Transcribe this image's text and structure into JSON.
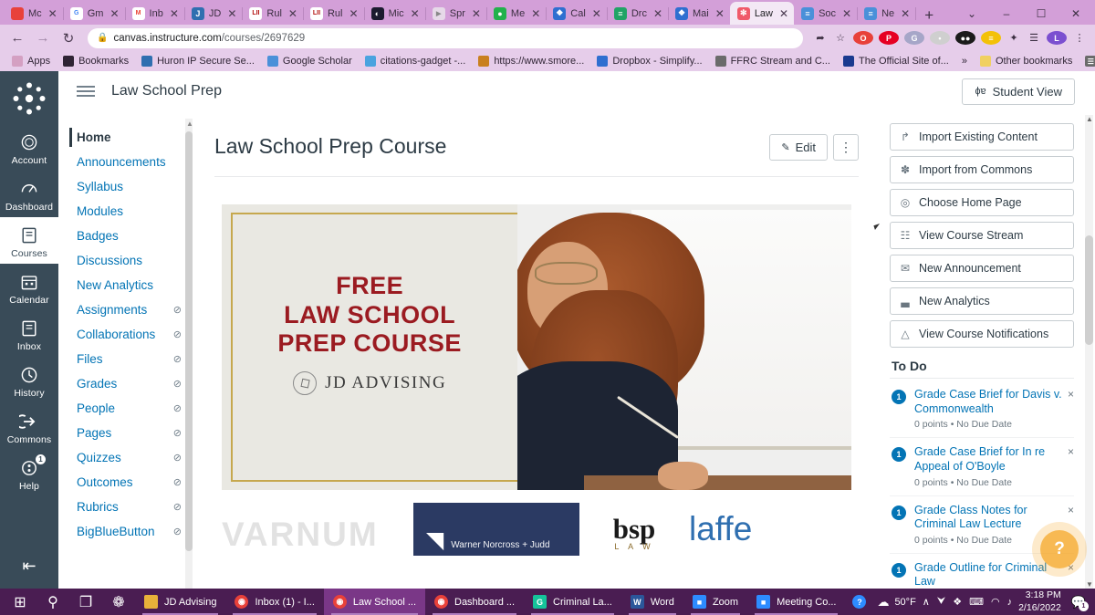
{
  "browser": {
    "tabs": [
      {
        "label": "Mc",
        "favicon": "red-circle-icon",
        "fav_color": "#e8413a",
        "active": false
      },
      {
        "label": "Gm",
        "favicon": "google-icon",
        "fav_color": "#ffffff",
        "active": false
      },
      {
        "label": "Inb",
        "favicon": "gmail-icon",
        "fav_color": "#ffffff",
        "active": false
      },
      {
        "label": "JD",
        "favicon": "jd-advising-icon",
        "fav_color": "#2f6fb0",
        "active": false
      },
      {
        "label": "Rul",
        "favicon": "lii-icon",
        "fav_color": "#ffffff",
        "active": false
      },
      {
        "label": "Rul",
        "favicon": "lii-icon",
        "fav_color": "#ffffff",
        "active": false
      },
      {
        "label": "Mic",
        "favicon": "globe-icon",
        "fav_color": "#1b1b2f",
        "active": false
      },
      {
        "label": "Spr",
        "favicon": "play-icon",
        "fav_color": "#e6d9e8",
        "active": false
      },
      {
        "label": "Me",
        "favicon": "green-circle-icon",
        "fav_color": "#22b14c",
        "active": false
      },
      {
        "label": "Cal",
        "favicon": "dropbox-icon",
        "fav_color": "#2f6fd0",
        "active": false
      },
      {
        "label": "Drc",
        "favicon": "sheets-icon",
        "fav_color": "#21a366",
        "active": false
      },
      {
        "label": "Mai",
        "favicon": "dropbox-icon",
        "fav_color": "#2f6fd0",
        "active": false
      },
      {
        "label": "Law",
        "favicon": "canvas-icon",
        "fav_color": "#f05a6a",
        "active": true
      },
      {
        "label": "Soc",
        "favicon": "document-icon",
        "fav_color": "#4a90d9",
        "active": false
      },
      {
        "label": "Ne",
        "favicon": "document-icon",
        "fav_color": "#4a90d9",
        "active": false
      }
    ],
    "new_tab_label": "+",
    "window_controls": [
      "⌄",
      "–",
      "☐",
      "✕"
    ],
    "nav": {
      "back": "←",
      "forward": "→",
      "reload": "↻"
    },
    "url_main": "canvas.instructure.com",
    "url_path": "/courses/2697629",
    "lock_icon": "lock-icon",
    "omnibox_icons": [
      {
        "name": "share-icon",
        "glyph": "➦"
      },
      {
        "name": "bookmark-star-icon",
        "glyph": "☆"
      },
      {
        "name": "opera-extension-icon",
        "glyph": "O",
        "color": "#e8413a"
      },
      {
        "name": "pinterest-extension-icon",
        "glyph": "P",
        "color": "#e60023"
      },
      {
        "name": "grammarly-extension-icon",
        "glyph": "G",
        "color": "#a6a6c8"
      },
      {
        "name": "lastpass-extension-icon",
        "glyph": "•",
        "color": "#cfcfcf"
      },
      {
        "name": "zoom-extension-icon",
        "glyph": "●●",
        "color": "#1b1b1b"
      },
      {
        "name": "notes-extension-icon",
        "glyph": "≡",
        "color": "#f3c108"
      },
      {
        "name": "extensions-puzzle-icon",
        "glyph": "✦"
      },
      {
        "name": "reading-list-icon",
        "glyph": "☰"
      },
      {
        "name": "profile-avatar-icon",
        "glyph": "L",
        "color": "#7b4fd0"
      },
      {
        "name": "chrome-menu-icon",
        "glyph": "⋮"
      }
    ],
    "bookmarks": [
      {
        "label": "Apps",
        "icon": "apps-grid-icon",
        "color": "#d4a0c2"
      },
      {
        "label": "Bookmarks",
        "icon": "star-icon",
        "color": "#2f2434"
      },
      {
        "label": "Huron IP Secure Se...",
        "icon": "huron-icon",
        "color": "#2f6fb0"
      },
      {
        "label": "Google Scholar",
        "icon": "scholar-icon",
        "color": "#4a90d9"
      },
      {
        "label": "citations-gadget -...",
        "icon": "home-icon",
        "color": "#4aa3df"
      },
      {
        "label": "https://www.smore...",
        "icon": "smore-icon",
        "color": "#c9801f"
      },
      {
        "label": "Dropbox - Simplify...",
        "icon": "dropbox-icon",
        "color": "#2f6fd0"
      },
      {
        "label": "FFRC Stream and C...",
        "icon": "wolf-icon",
        "color": "#6b6b6b"
      },
      {
        "label": "The Official Site of...",
        "icon": "flag-icon",
        "color": "#1a3a8f"
      }
    ],
    "bookmarks_overflow": "»",
    "other_bookmarks": "Other bookmarks",
    "reading_list": "Reading list"
  },
  "canvas": {
    "global_nav": {
      "logo_name": "canvas-logo",
      "items": [
        {
          "label": "Account",
          "icon": "account-avatar-icon",
          "active": false,
          "badge": null
        },
        {
          "label": "Dashboard",
          "icon": "dashboard-icon",
          "active": false,
          "badge": null
        },
        {
          "label": "Courses",
          "icon": "courses-book-icon",
          "active": true,
          "badge": null
        },
        {
          "label": "Calendar",
          "icon": "calendar-icon",
          "active": false,
          "badge": null
        },
        {
          "label": "Inbox",
          "icon": "inbox-icon",
          "active": false,
          "badge": null
        },
        {
          "label": "History",
          "icon": "history-clock-icon",
          "active": false,
          "badge": null
        },
        {
          "label": "Commons",
          "icon": "commons-icon",
          "active": false,
          "badge": null
        },
        {
          "label": "Help",
          "icon": "help-icon",
          "active": false,
          "badge": "1"
        }
      ],
      "collapse_label": "⇤"
    },
    "header": {
      "menu_icon": "hamburger-menu-icon",
      "course_name": "Law School Prep",
      "student_view_label": "Student View",
      "student_view_icon": "eye-glasses-icon"
    },
    "course_nav": [
      {
        "label": "Home",
        "active": true,
        "hidden": false
      },
      {
        "label": "Announcements",
        "active": false,
        "hidden": false
      },
      {
        "label": "Syllabus",
        "active": false,
        "hidden": false
      },
      {
        "label": "Modules",
        "active": false,
        "hidden": false
      },
      {
        "label": "Badges",
        "active": false,
        "hidden": false
      },
      {
        "label": "Discussions",
        "active": false,
        "hidden": false
      },
      {
        "label": "New Analytics",
        "active": false,
        "hidden": false
      },
      {
        "label": "Assignments",
        "active": false,
        "hidden": true
      },
      {
        "label": "Collaborations",
        "active": false,
        "hidden": true
      },
      {
        "label": "Files",
        "active": false,
        "hidden": true
      },
      {
        "label": "Grades",
        "active": false,
        "hidden": true
      },
      {
        "label": "People",
        "active": false,
        "hidden": true
      },
      {
        "label": "Pages",
        "active": false,
        "hidden": true
      },
      {
        "label": "Quizzes",
        "active": false,
        "hidden": true
      },
      {
        "label": "Outcomes",
        "active": false,
        "hidden": true
      },
      {
        "label": "Rubrics",
        "active": false,
        "hidden": true
      },
      {
        "label": "BigBlueButton",
        "active": false,
        "hidden": true
      }
    ],
    "page": {
      "title": "Law School Prep Course",
      "edit_label": "Edit",
      "edit_icon": "pencil-icon",
      "kebab_label": "⋮"
    },
    "hero": {
      "line1": "FREE",
      "line2": "LAW SCHOOL",
      "line3": "PREP COURSE",
      "brand": "JD ADVISING",
      "brand_icon": "jd-seal-icon",
      "title_color": "#9b1b21",
      "frame_color": "#c6a84e"
    },
    "logos": [
      {
        "name": "varnum-logo",
        "text": "VARNUM"
      },
      {
        "name": "warner-norcross-judd-logo",
        "text": "Warner Norcross + Judd"
      },
      {
        "name": "bsp-law-logo",
        "text": "bsp",
        "sub": "L A W"
      },
      {
        "name": "laffe-logo",
        "text": "laffe"
      }
    ],
    "right_rail": {
      "buttons": [
        {
          "label": "Import Existing Content",
          "icon": "import-icon",
          "glyph": "↱"
        },
        {
          "label": "Import from Commons",
          "icon": "commons-icon",
          "glyph": "✽"
        },
        {
          "label": "Choose Home Page",
          "icon": "target-icon",
          "glyph": "◎"
        },
        {
          "label": "View Course Stream",
          "icon": "stream-icon",
          "glyph": "☷"
        },
        {
          "label": "New Announcement",
          "icon": "announcement-icon",
          "glyph": "✉"
        },
        {
          "label": "New Analytics",
          "icon": "analytics-icon",
          "glyph": "▃"
        },
        {
          "label": "View Course Notifications",
          "icon": "bell-icon",
          "glyph": "△"
        }
      ],
      "todo_heading": "To Do",
      "todo_items": [
        {
          "count": "1",
          "title": "Grade Case Brief for Davis v. Commonwealth",
          "meta": "0 points • No Due Date",
          "close": "×"
        },
        {
          "count": "1",
          "title": "Grade Case Brief for In re Appeal of O'Boyle",
          "meta": "0 points • No Due Date",
          "close": "×"
        },
        {
          "count": "1",
          "title": "Grade Class Notes for Criminal Law Lecture",
          "meta": "0 points • No Due Date",
          "close": "×"
        },
        {
          "count": "1",
          "title": "Grade Outline for Criminal Law",
          "meta": "",
          "close": "×"
        }
      ],
      "help_bubble_label": "?"
    }
  },
  "taskbar": {
    "system": [
      {
        "name": "start-button",
        "glyph": "⊞"
      },
      {
        "name": "search-icon",
        "glyph": "⚲"
      },
      {
        "name": "task-view-icon",
        "glyph": "❐"
      },
      {
        "name": "cortana-icon",
        "glyph": "❁"
      }
    ],
    "apps": [
      {
        "label": "JD Advising",
        "icon": "folder-icon",
        "color": "#e8b23a",
        "active": false,
        "open": true
      },
      {
        "label": "Inbox (1) - I...",
        "icon": "chrome-icon",
        "color": "#e8413a",
        "active": false,
        "open": true
      },
      {
        "label": "Law School ...",
        "icon": "chrome-icon",
        "color": "#e8413a",
        "active": true,
        "open": true
      },
      {
        "label": "Dashboard ...",
        "icon": "chrome-icon",
        "color": "#e8413a",
        "active": false,
        "open": true
      },
      {
        "label": "Criminal La...",
        "icon": "grammarly-icon",
        "color": "#15c39a",
        "active": false,
        "open": true
      },
      {
        "label": "Word",
        "icon": "word-icon",
        "color": "#2b579a",
        "active": false,
        "open": true
      },
      {
        "label": "Zoom",
        "icon": "zoom-icon",
        "color": "#2d8cff",
        "active": false,
        "open": true
      },
      {
        "label": "Meeting Co...",
        "icon": "zoom-icon",
        "color": "#2d8cff",
        "active": false,
        "open": true
      }
    ],
    "question_icon": {
      "name": "help-question-icon",
      "glyph": "?"
    },
    "weather": {
      "icon": "cloud-icon",
      "temp": "50°F"
    },
    "tray": [
      {
        "name": "chevron-up-icon",
        "glyph": "∧"
      },
      {
        "name": "microphone-icon",
        "glyph": "⮟"
      },
      {
        "name": "dropbox-tray-icon",
        "glyph": "❖"
      },
      {
        "name": "keyboard-icon",
        "glyph": "⌨"
      },
      {
        "name": "wifi-icon",
        "glyph": "◠"
      },
      {
        "name": "volume-icon",
        "glyph": "♪"
      }
    ],
    "clock_time": "3:18 PM",
    "clock_date": "2/16/2022",
    "notification_badge": "1"
  }
}
